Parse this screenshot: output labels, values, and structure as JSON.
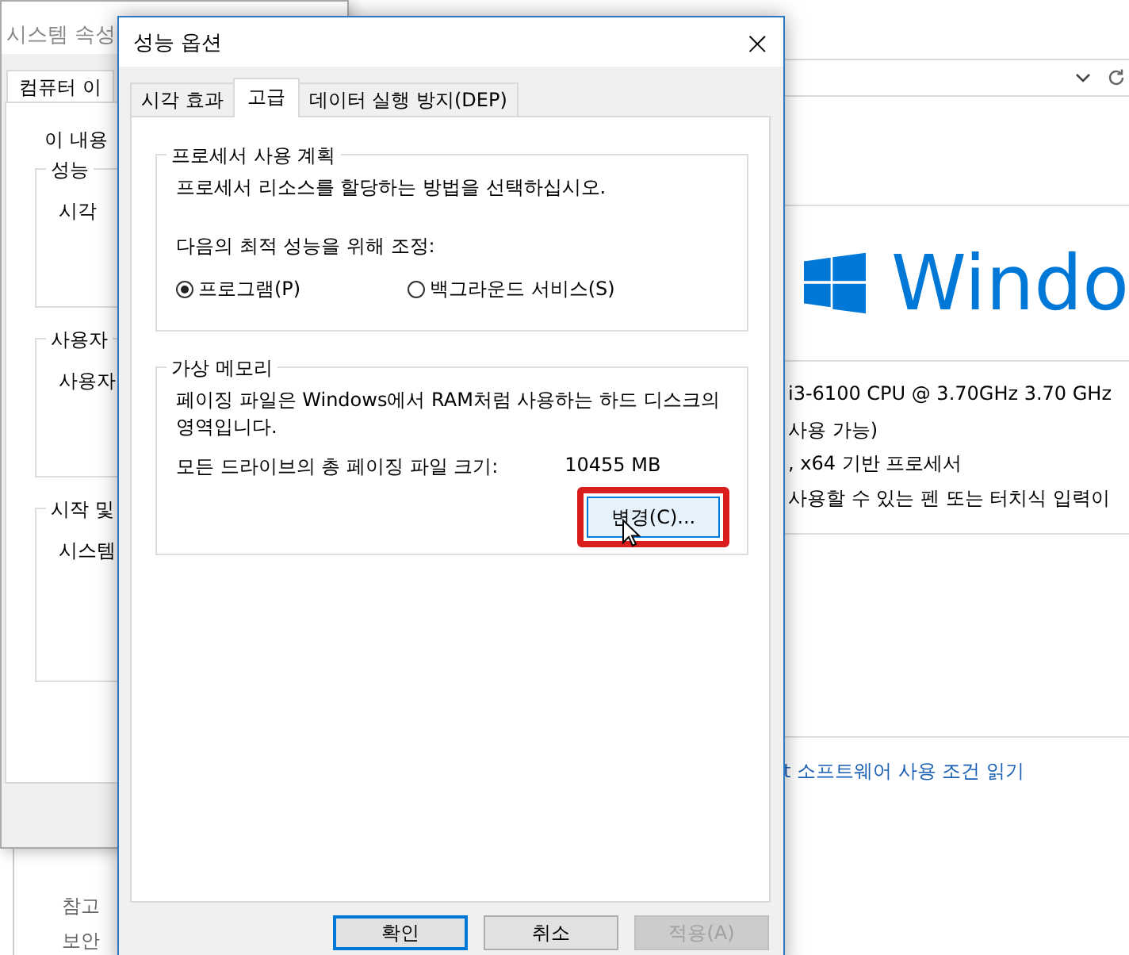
{
  "control_panel": {
    "hardware_lines": [
      "i3-6100 CPU @ 3.70GHz   3.70 GHz",
      "사용 가능)",
      ", x64 기반 프로세서",
      "사용할 수 있는 펜 또는 터치식 입력이"
    ],
    "logo_text": "Windo",
    "license_link": "t 소프트웨어 사용 조건 읽기",
    "see_also": [
      "참고",
      "보안"
    ]
  },
  "system_properties": {
    "title": "시스템 속성",
    "tabs": [
      {
        "label": "컴퓨터 이",
        "selected": true
      }
    ],
    "intro": "이 내용",
    "groups": [
      {
        "title": "성능",
        "text": "시각"
      },
      {
        "title": "사용자",
        "text": "사용자"
      },
      {
        "title": "시작 및",
        "text": "시스템"
      }
    ]
  },
  "dialog": {
    "title": "성능 옵션",
    "close": "×",
    "tabs": [
      {
        "label": "시각 효과",
        "selected": false
      },
      {
        "label": "고급",
        "selected": true
      },
      {
        "label": "데이터 실행 방지(DEP)",
        "selected": false
      }
    ],
    "processor": {
      "title": "프로세서 사용 계획",
      "description": "프로세서 리소스를 할당하는 방법을 선택하십시오.",
      "adjust_label": "다음의 최적 성능을 위해 조정:",
      "options": [
        {
          "label": "프로그램(P)",
          "selected": true
        },
        {
          "label": "백그라운드 서비스(S)",
          "selected": false
        }
      ]
    },
    "virtual_memory": {
      "title": "가상 메모리",
      "description": "페이징 파일은 Windows에서 RAM처럼 사용하는 하드 디스크의 영역입니다.",
      "total_label": "모든 드라이브의 총 페이징 파일 크기:",
      "total_value": "10455 MB",
      "change_button": {
        "label": "변경(C)...",
        "highlighted": true
      }
    },
    "buttons": [
      {
        "label": "확인",
        "focused": true,
        "disabled": false
      },
      {
        "label": "취소",
        "focused": false,
        "disabled": false
      },
      {
        "label": "적용(A)",
        "focused": false,
        "disabled": true
      }
    ]
  }
}
